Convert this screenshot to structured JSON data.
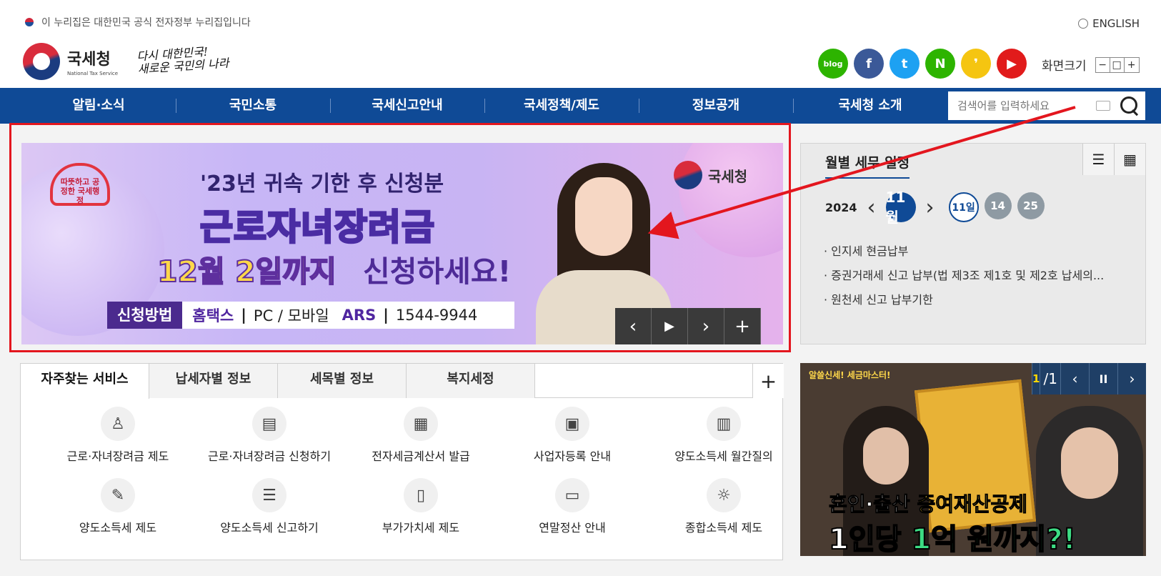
{
  "gov_notice": "이 누리집은 대한민국 공식 전자정부 누리집입니다",
  "english": "ENGLISH",
  "logo": {
    "name": "국세청",
    "sub": "National Tax Service"
  },
  "slogan": [
    "다시 대한민국!",
    "새로운 국민의 나라"
  ],
  "social": [
    {
      "name": "blog",
      "icon": "blog",
      "color": "#2db400"
    },
    {
      "name": "facebook",
      "icon": "f",
      "color": "#3b5998"
    },
    {
      "name": "twitter",
      "icon": "t",
      "color": "#1da1f2"
    },
    {
      "name": "naver-tv",
      "icon": "N",
      "color": "#2db400"
    },
    {
      "name": "kakao",
      "icon": "❜",
      "color": "#f5c511"
    },
    {
      "name": "youtube",
      "icon": "▶",
      "color": "#e11b1b"
    }
  ],
  "size": {
    "label": "화면크기",
    "buttons": [
      "−",
      "□",
      "+"
    ]
  },
  "nav": [
    "알림·소식",
    "국민소통",
    "국세신고안내",
    "국세정책/제도",
    "정보공개",
    "국세청 소개"
  ],
  "search": {
    "placeholder": "검색어를 입력하세요"
  },
  "banner": {
    "badge": "따뜻하고 공정한 국세행정",
    "sub": "'23년 귀속 기한 후 신청분",
    "main": "근로자녀장려금",
    "date": "12월 2일까지",
    "apply": "신청하세요!",
    "method_label": "신청방법",
    "method_hometax": "홈택스",
    "method_pc": "PC / 모바일",
    "method_ars": "ARS",
    "method_phone": "1544-9944",
    "logo": "국세청",
    "controls": [
      "‹",
      "▶",
      "›",
      "+"
    ]
  },
  "schedule": {
    "title": "월별 세무 일정",
    "year": "2024",
    "month": "11월",
    "days": [
      "11일",
      "14",
      "25"
    ],
    "items": [
      "인지세 현금납부",
      "증권거래세 신고 납부(법 제3조 제1호 및 제2호 납세의...",
      "원천세 신고 납부기한"
    ]
  },
  "services": {
    "tabs": [
      "자주찾는 서비스",
      "납세자별 정보",
      "세목별 정보",
      "복지세정"
    ],
    "plus": "+",
    "items": [
      {
        "label": "근로·자녀장려금 제도",
        "icon": "people-icon"
      },
      {
        "label": "근로·자녀장려금 신청하기",
        "icon": "document-icon"
      },
      {
        "label": "전자세금계산서 발급",
        "icon": "calculator-icon"
      },
      {
        "label": "사업자등록 안내",
        "icon": "id-card-icon"
      },
      {
        "label": "양도소득세 월간질의",
        "icon": "building-icon"
      },
      {
        "label": "양도소득세 제도",
        "icon": "pen-icon"
      },
      {
        "label": "양도소득세 신고하기",
        "icon": "form-icon"
      },
      {
        "label": "부가가치세 제도",
        "icon": "book-icon"
      },
      {
        "label": "연말정산 안내",
        "icon": "monitor-icon"
      },
      {
        "label": "종합소득세 제도",
        "icon": "bulb-person-icon"
      }
    ]
  },
  "video": {
    "tag": "알쓸신세! 세금마스터!",
    "counter_current": "1",
    "counter_total": "/1",
    "line1_a": "혼인·출산 ",
    "line1_b": "증여재산공제",
    "line2_a": "1인당 ",
    "line2_b": "1억 원까지?!",
    "controls": [
      "‹",
      "II",
      "›"
    ]
  }
}
